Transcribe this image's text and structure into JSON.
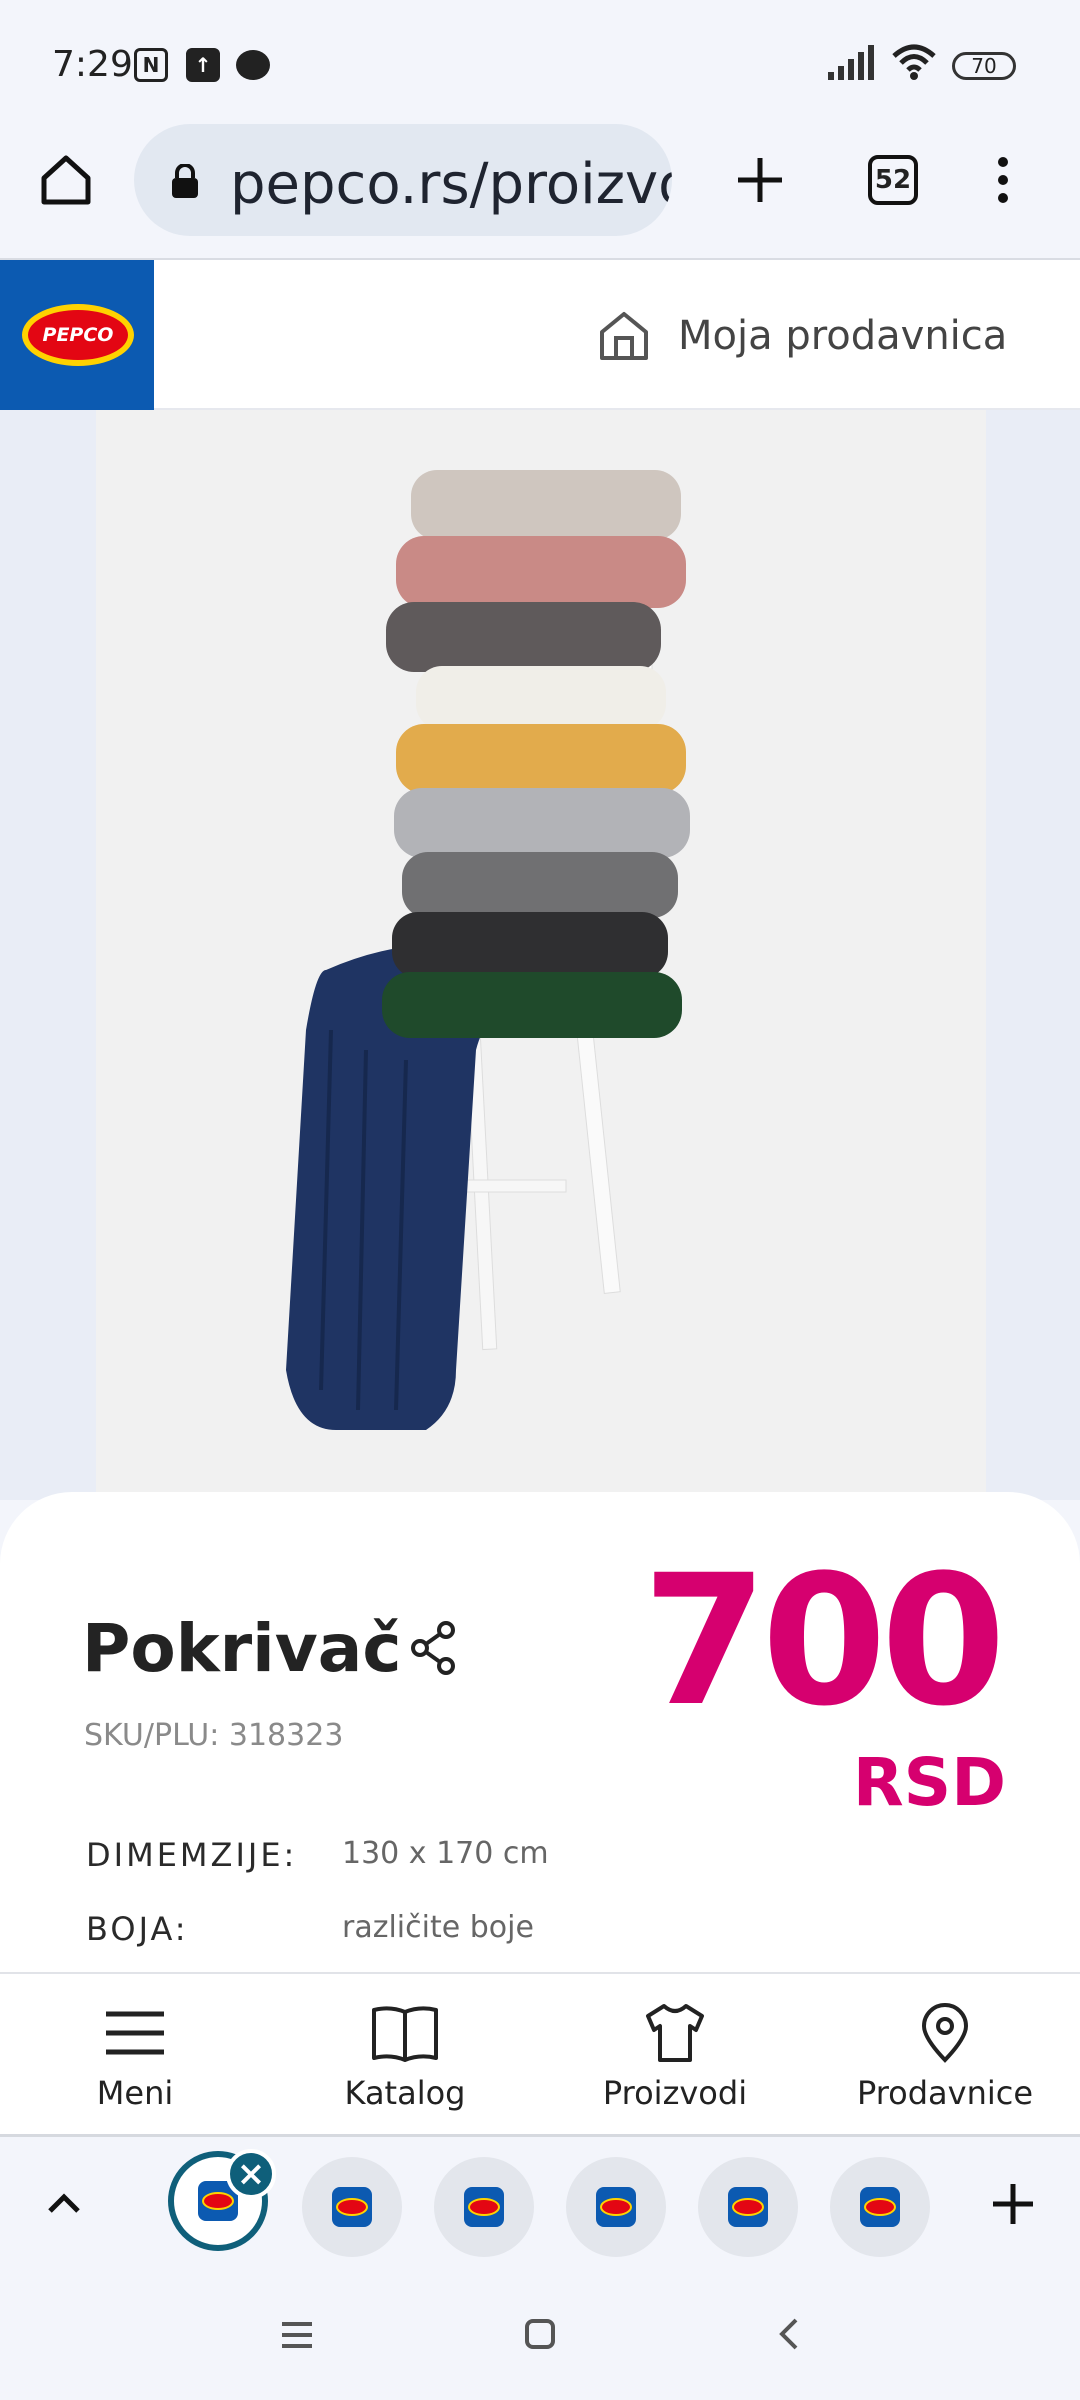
{
  "status_bar": {
    "time": "7:29",
    "icons": [
      "nfc-icon",
      "upload-icon",
      "chat-icon"
    ],
    "battery": "70"
  },
  "browser": {
    "url": "pepco.rs/proizvodi",
    "tab_count": "52"
  },
  "site_header": {
    "logo_text": "PEPCO",
    "store_label": "Moja prodavnica"
  },
  "product": {
    "title": "Pokrivač",
    "sku": "SKU/PLU: 318323",
    "price": "700",
    "currency": "RSD",
    "specs": [
      {
        "label": "DIMEMZIJE:",
        "value": "130 x 170 cm"
      },
      {
        "label": "BOJA:",
        "value": "različite boje"
      }
    ],
    "blanket_colors": [
      "#cfc6bf",
      "#c98a86",
      "#5f5a5b",
      "#f0eee8",
      "#e2ab4c",
      "#b2b3b7",
      "#707072",
      "#2f2f31",
      "#1f4a2b",
      "#1f3463"
    ]
  },
  "bottom_nav": {
    "items": [
      {
        "label": "Meni",
        "icon": "menu-icon"
      },
      {
        "label": "Katalog",
        "icon": "book-icon"
      },
      {
        "label": "Proizvodi",
        "icon": "shirt-icon"
      },
      {
        "label": "Prodavnice",
        "icon": "location-pin-icon"
      }
    ]
  },
  "tab_strip": {
    "tabs": 6,
    "active_index": 0
  },
  "colors": {
    "brand_blue": "#0c5ab1",
    "price_pink": "#d6006f",
    "accent_teal": "#0f5f7a"
  }
}
